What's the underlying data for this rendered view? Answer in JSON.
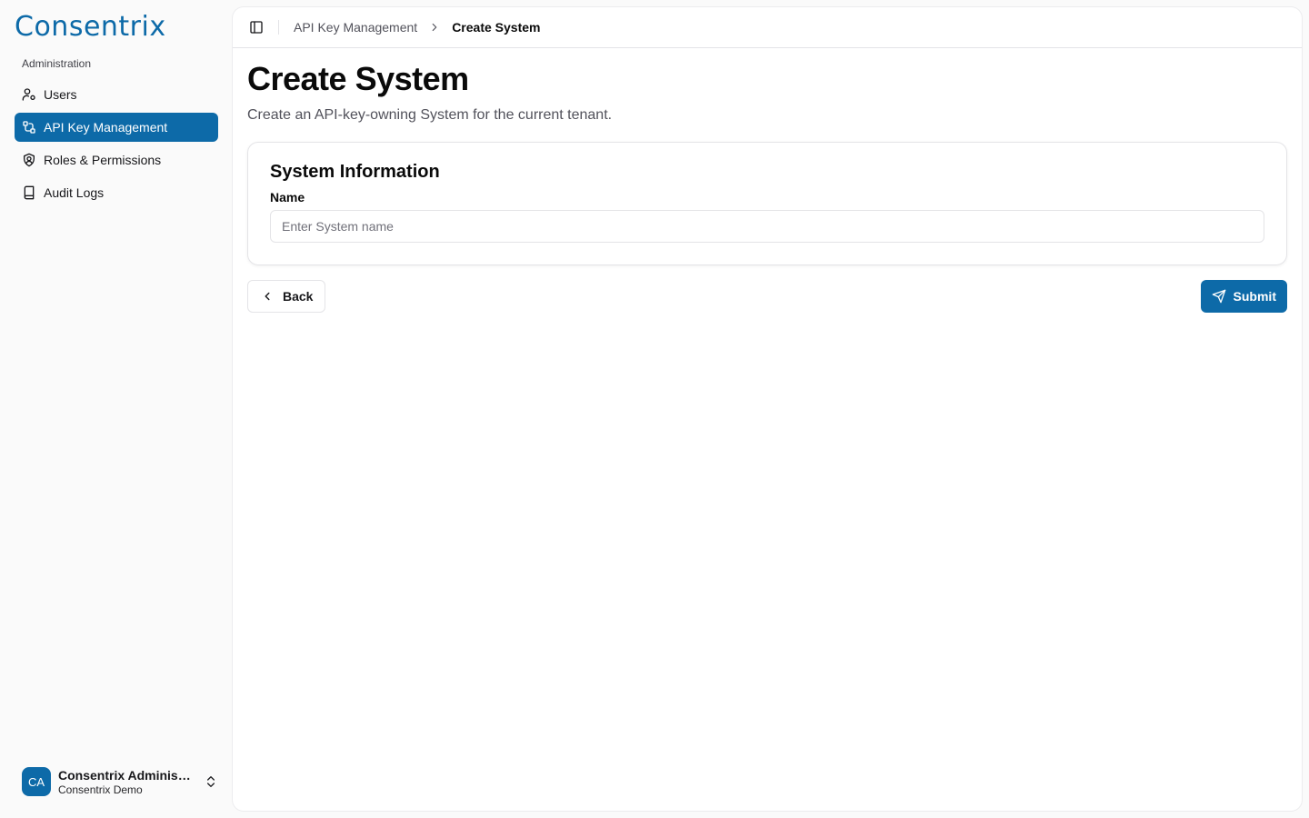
{
  "brand": {
    "name": "Consentrix",
    "color": "#0d6aa8"
  },
  "sidebar": {
    "group_label": "Administration",
    "items": [
      {
        "label": "Users",
        "icon": "user-cog-icon",
        "active": false
      },
      {
        "label": "API Key Management",
        "icon": "key-route-icon",
        "active": true
      },
      {
        "label": "Roles & Permissions",
        "icon": "shield-user-icon",
        "active": false
      },
      {
        "label": "Audit Logs",
        "icon": "book-icon",
        "active": false
      }
    ]
  },
  "user": {
    "initials": "CA",
    "name": "Consentrix Administrator",
    "org": "Consentrix Demo"
  },
  "breadcrumb": {
    "parent": "API Key Management",
    "current": "Create System"
  },
  "page": {
    "title": "Create System",
    "subtitle": "Create an API-key-owning System for the current tenant."
  },
  "form": {
    "section_title": "System Information",
    "name_label": "Name",
    "name_placeholder": "Enter System name",
    "name_value": ""
  },
  "actions": {
    "back_label": "Back",
    "submit_label": "Submit"
  }
}
